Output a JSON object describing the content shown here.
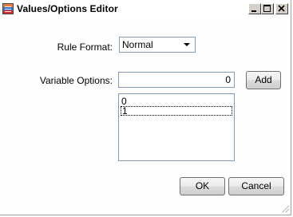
{
  "window": {
    "title": "Values/Options Editor",
    "app_icon": "app-grid-icon",
    "controls": [
      "minimize-icon",
      "maximize-icon",
      "close-icon"
    ]
  },
  "form": {
    "rule_format_label": "Rule Format:",
    "rule_format_value": "Normal",
    "variable_options_label": "Variable Options:",
    "variable_value": "0",
    "add_label": "Add",
    "options_list": [
      "0",
      "1"
    ],
    "selected_index": 1
  },
  "footer": {
    "ok_label": "OK",
    "cancel_label": "Cancel"
  },
  "colors": {
    "input_border": "#7f9db9",
    "button_face": "#ebebeb",
    "caption_button": "#d4d0c8"
  }
}
